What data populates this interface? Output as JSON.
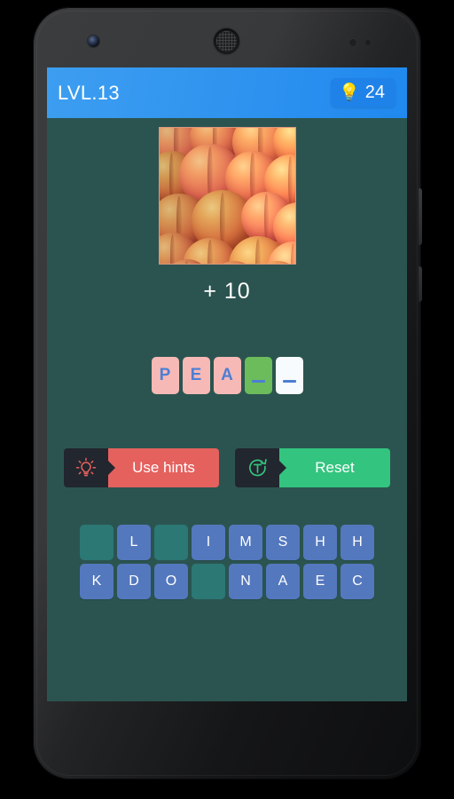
{
  "appbar": {
    "level_label": "LVL.13",
    "hint_icon": "lightbulb-icon",
    "hint_count": "24",
    "bar_color": "#2f93ef",
    "badge_color": "#1f82e8"
  },
  "puzzle": {
    "image_alt": "peaches",
    "score_text": "+ 10",
    "background_color": "#2b5450"
  },
  "answer": {
    "slots": [
      {
        "letter": "P",
        "state": "filled"
      },
      {
        "letter": "E",
        "state": "filled"
      },
      {
        "letter": "A",
        "state": "filled"
      },
      {
        "letter": "",
        "state": "active"
      },
      {
        "letter": "",
        "state": "empty"
      }
    ],
    "filled_color": "#f7b9b6",
    "active_color": "#6cbc5b",
    "empty_color": "#f7fbfd",
    "letter_color": "#4c7fd4"
  },
  "actions": {
    "hints": {
      "label": "Use hints",
      "icon": "lightbulb-outline-icon",
      "color": "#e4615e"
    },
    "reset": {
      "label": "Reset",
      "icon": "reset-circular-arrow-icon",
      "color": "#33c47f"
    },
    "icon_box_color": "#22262e"
  },
  "keyboard": {
    "key_color": "#5478be",
    "used_key_color": "#2b7875",
    "rows": [
      [
        {
          "letter": "",
          "used": true
        },
        {
          "letter": "L",
          "used": false
        },
        {
          "letter": "",
          "used": true
        },
        {
          "letter": "I",
          "used": false
        },
        {
          "letter": "M",
          "used": false
        },
        {
          "letter": "S",
          "used": false
        },
        {
          "letter": "H",
          "used": false
        },
        {
          "letter": "H",
          "used": false
        }
      ],
      [
        {
          "letter": "K",
          "used": false
        },
        {
          "letter": "D",
          "used": false
        },
        {
          "letter": "O",
          "used": false
        },
        {
          "letter": "",
          "used": true
        },
        {
          "letter": "N",
          "used": false
        },
        {
          "letter": "A",
          "used": false
        },
        {
          "letter": "E",
          "used": false
        },
        {
          "letter": "C",
          "used": false
        }
      ]
    ]
  }
}
